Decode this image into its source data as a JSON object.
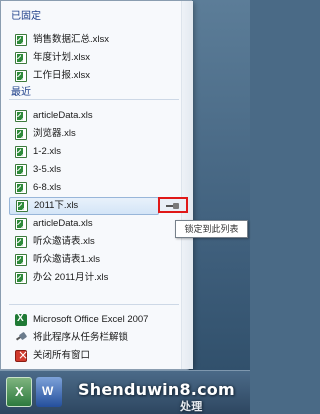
{
  "pinned": {
    "header": "已固定",
    "items": [
      {
        "label": "销售数据汇总.xlsx",
        "icon": "excel-file-icon"
      },
      {
        "label": "年度计划.xlsx",
        "icon": "excel-file-icon"
      },
      {
        "label": "工作日报.xlsx",
        "icon": "excel-file-icon"
      }
    ]
  },
  "recent": {
    "header": "最近",
    "items": [
      {
        "label": "articleData.xls",
        "icon": "excel-file-icon"
      },
      {
        "label": "浏览器.xls",
        "icon": "excel-file-icon"
      },
      {
        "label": "1-2.xls",
        "icon": "excel-file-icon"
      },
      {
        "label": "3-5.xls",
        "icon": "excel-file-icon"
      },
      {
        "label": "6-8.xls",
        "icon": "excel-file-icon"
      },
      {
        "label": "2011下.xls",
        "icon": "excel-file-icon",
        "highlighted": true
      },
      {
        "label": "articleData.xls",
        "icon": "excel-file-icon"
      },
      {
        "label": "听众邀请表.xls",
        "icon": "excel-file-icon"
      },
      {
        "label": "听众邀请表1.xls",
        "icon": "excel-file-icon"
      },
      {
        "label": "办公 2011月计.xls",
        "icon": "excel-file-icon"
      }
    ]
  },
  "pin_tooltip": "锁定到此列表",
  "tasks": [
    {
      "label": "Microsoft Office Excel 2007",
      "icon": "excel-app-icon"
    },
    {
      "label": "将此程序从任务栏解锁",
      "icon": "unpin-icon"
    },
    {
      "label": "关闭所有窗口",
      "icon": "close-window-icon"
    }
  ],
  "watermark": {
    "main": "Shenduwin8.com",
    "sub": "处理"
  },
  "colors": {
    "header_text": "#1e3f8a",
    "highlight_border": "#98b6d9",
    "pin_frame": "#e01818"
  }
}
